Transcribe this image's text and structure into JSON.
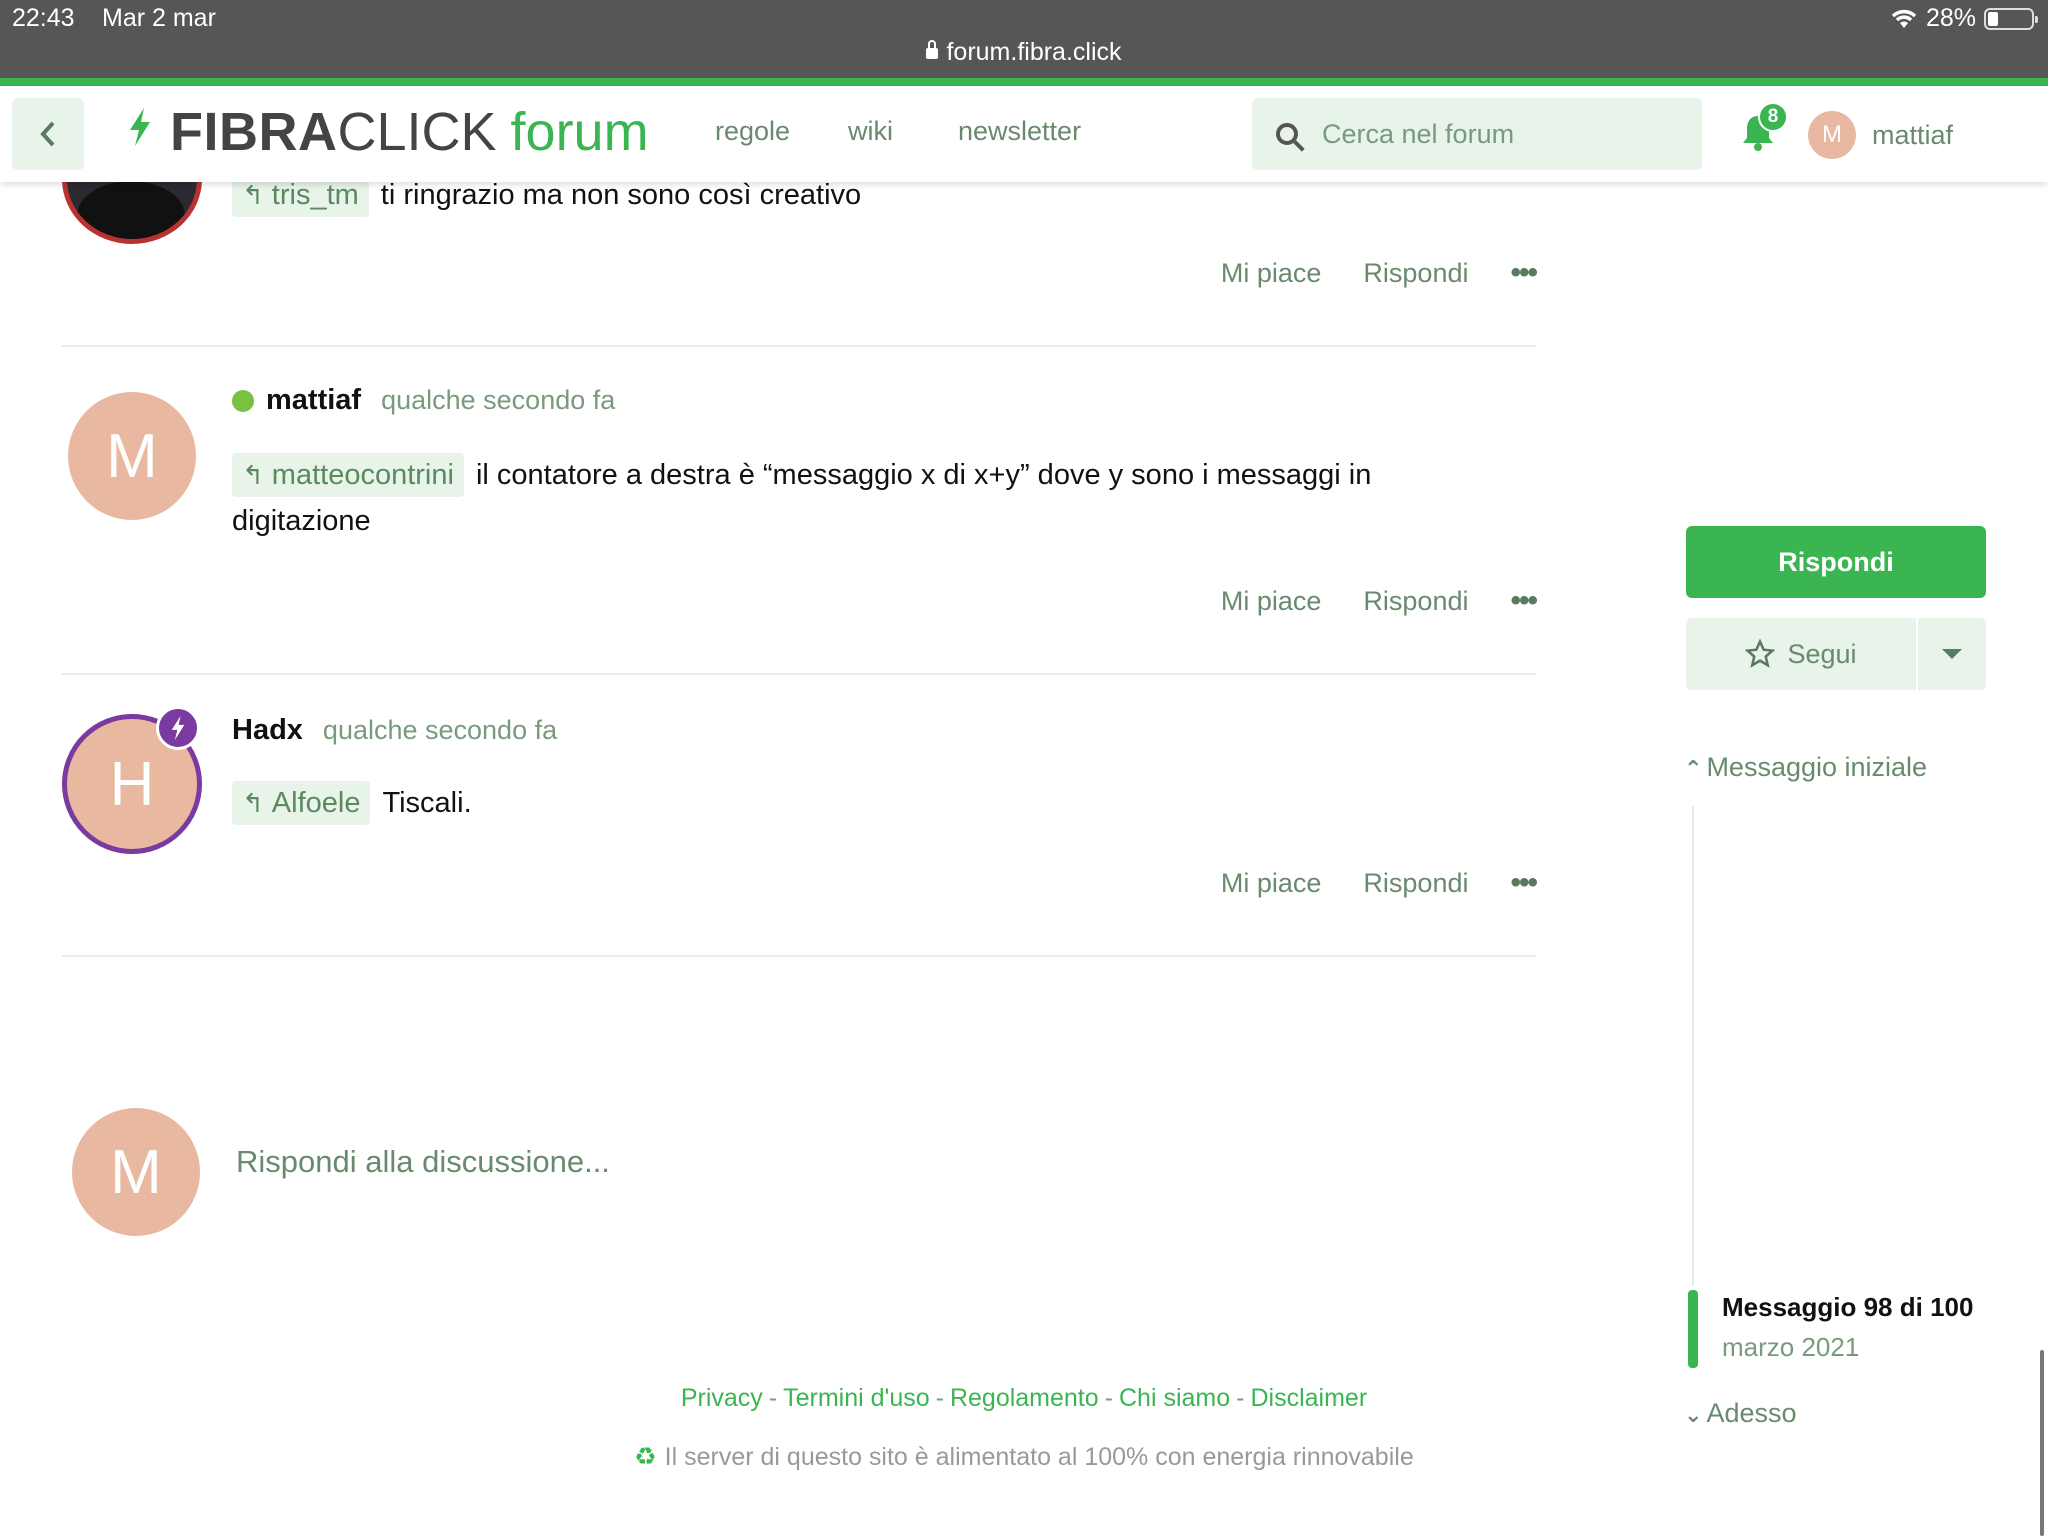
{
  "status_bar": {
    "time": "22:43",
    "date": "Mar 2 mar",
    "url": "forum.fibra.click",
    "battery": "28%"
  },
  "header": {
    "logo_part1": "FIBRA",
    "logo_part2": "CLICK",
    "logo_part3": "forum",
    "nav": [
      "regole",
      "wiki",
      "newsletter"
    ],
    "search_placeholder": "Cerca nel forum",
    "notification_count": "8",
    "user_initial": "M",
    "username": "mattiaf"
  },
  "posts": [
    {
      "mention": "tris_tm",
      "text": "ti ringrazio ma non sono così creativo",
      "actions": {
        "like": "Mi piace",
        "reply": "Rispondi"
      }
    },
    {
      "avatar": "M",
      "username": "mattiaf",
      "time": "qualche secondo fa",
      "mention": "matteocontrini",
      "text": "il contatore a destra è “messaggio x di x+y” dove y sono i messaggi in digitazione",
      "actions": {
        "like": "Mi piace",
        "reply": "Rispondi"
      }
    },
    {
      "avatar": "H",
      "username": "Hadx",
      "time": "qualche secondo fa",
      "mention": "Alfoele",
      "text": "Tiscali.",
      "actions": {
        "like": "Mi piace",
        "reply": "Rispondi"
      }
    }
  ],
  "composer": {
    "avatar": "M",
    "placeholder": "Rispondi alla discussione..."
  },
  "footer": {
    "links": [
      "Privacy",
      "Termini d'uso",
      "Regolamento",
      "Chi siamo",
      "Disclaimer"
    ],
    "eco_text": "Il server di questo sito è alimentato al 100% con energia rinnovabile"
  },
  "sidebar": {
    "reply_label": "Rispondi",
    "follow_label": "Segui",
    "scrubber_top": "Messaggio iniziale",
    "scrubber_count": "Messaggio 98 di 100",
    "scrubber_date": "marzo 2021",
    "scrubber_bottom": "Adesso"
  },
  "colors": {
    "accent": "#3bb552",
    "muted_green": "#6a8a6e",
    "avatar_bg": "#e8b8a0",
    "moderator": "#7a3aa0"
  }
}
